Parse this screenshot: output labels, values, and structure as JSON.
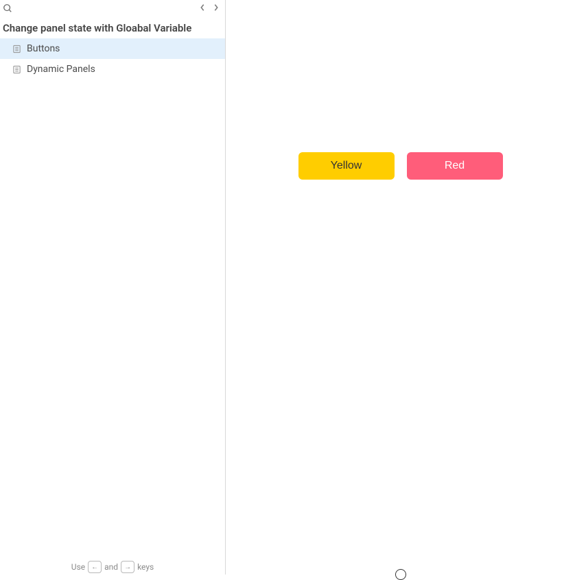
{
  "sidebar": {
    "title": "Change panel state with Gloabal Variable",
    "items": [
      {
        "label": "Buttons",
        "active": true
      },
      {
        "label": "Dynamic Panels",
        "active": false
      }
    ],
    "footer": {
      "prefix": "Use",
      "key_left": "←",
      "middle": "and",
      "key_right": "→",
      "suffix": "keys"
    }
  },
  "buttons": {
    "yellow": "Yellow",
    "red": "Red"
  },
  "colors": {
    "yellow": "#ffcd00",
    "red": "#ff5d7a",
    "active_sidebar": "#e2f0fc"
  }
}
